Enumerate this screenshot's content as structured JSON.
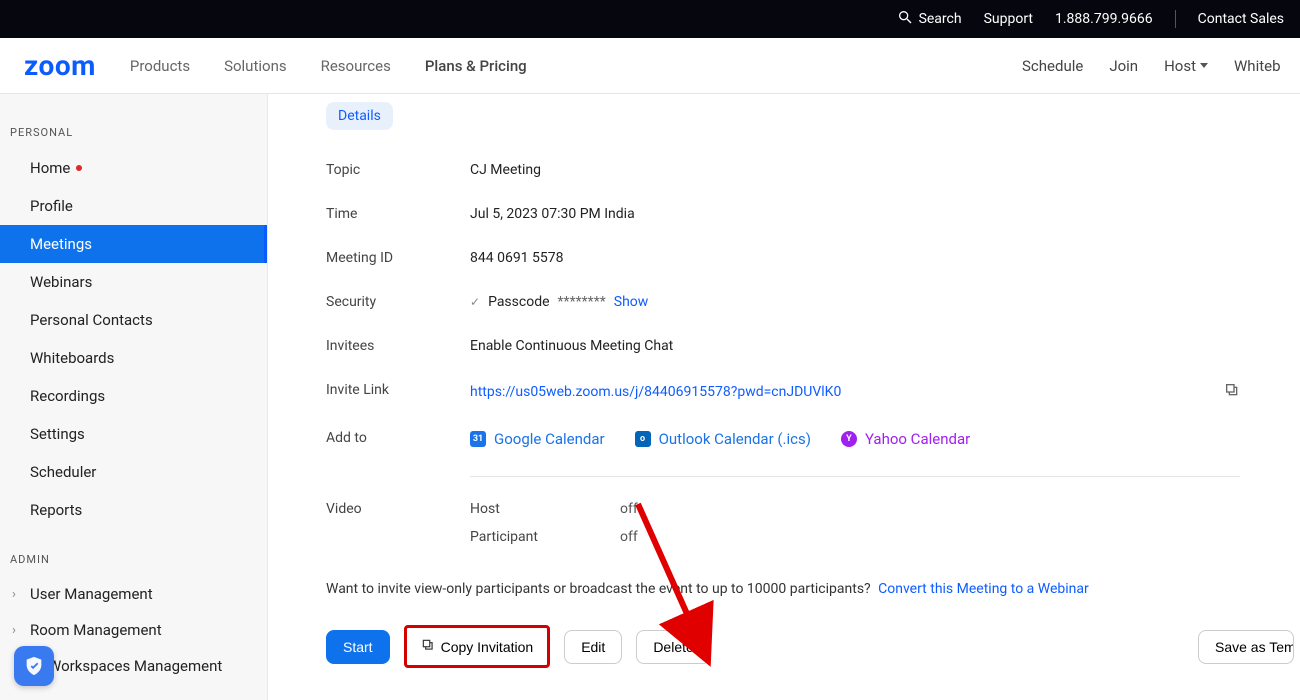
{
  "topbar": {
    "search": "Search",
    "support": "Support",
    "phone": "1.888.799.9666",
    "contact_sales": "Contact Sales"
  },
  "nav": {
    "logo": "zoom",
    "products": "Products",
    "solutions": "Solutions",
    "resources": "Resources",
    "pricing": "Plans & Pricing",
    "schedule": "Schedule",
    "join": "Join",
    "host": "Host",
    "whiteboard": "Whiteboard"
  },
  "sidebar": {
    "personal_label": "PERSONAL",
    "items": [
      {
        "label": "Home",
        "badge": true
      },
      {
        "label": "Profile"
      },
      {
        "label": "Meetings",
        "active": true
      },
      {
        "label": "Webinars"
      },
      {
        "label": "Personal Contacts"
      },
      {
        "label": "Whiteboards"
      },
      {
        "label": "Recordings"
      },
      {
        "label": "Settings"
      },
      {
        "label": "Scheduler"
      },
      {
        "label": "Reports"
      }
    ],
    "admin_label": "ADMIN",
    "admin_items": [
      {
        "label": "User Management"
      },
      {
        "label": "Room Management"
      },
      {
        "label": "Workspaces Management"
      }
    ]
  },
  "details": {
    "tab": "Details",
    "topic_label": "Topic",
    "topic": "CJ Meeting",
    "time_label": "Time",
    "time": "Jul 5, 2023 07:30 PM India",
    "meeting_id_label": "Meeting ID",
    "meeting_id": "844 0691 5578",
    "security_label": "Security",
    "passcode_label": "Passcode",
    "passcode_mask": "********",
    "show": "Show",
    "invitees_label": "Invitees",
    "invitees": "Enable Continuous Meeting Chat",
    "invite_link_label": "Invite Link",
    "invite_link": "https://us05web.zoom.us/j/84406915578?pwd=cnJDUVlK0",
    "addto_label": "Add to",
    "google_cal": "Google Calendar",
    "outlook_cal": "Outlook Calendar (.ics)",
    "yahoo_cal": "Yahoo Calendar",
    "video_label": "Video",
    "host_label": "Host",
    "host_value": "off",
    "participant_label": "Participant",
    "participant_value": "off",
    "webinar_text": "Want to invite view-only participants or broadcast the event to up to 10000 participants?",
    "webinar_link": "Convert this Meeting to a Webinar"
  },
  "actions": {
    "start": "Start",
    "copy_invitation": "Copy Invitation",
    "edit": "Edit",
    "delete": "Delete",
    "save_template": "Save as Template"
  }
}
